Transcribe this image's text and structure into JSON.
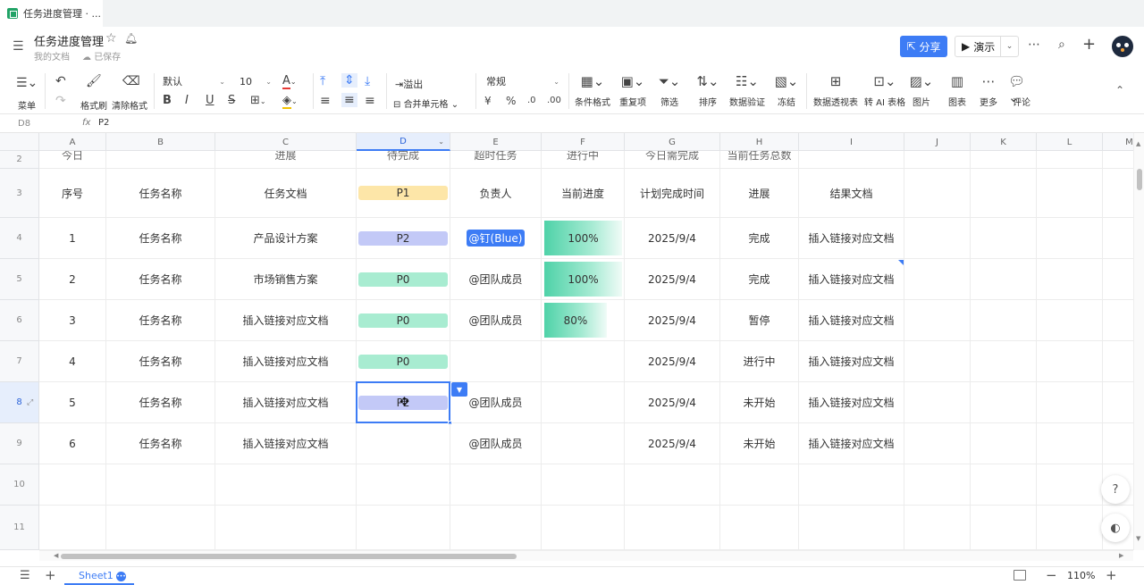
{
  "browser_tab": {
    "title": "任务进度管理 · ..."
  },
  "doc": {
    "title": "任务进度管理",
    "folder": "我的文档",
    "save_status": "已保存"
  },
  "header": {
    "share": "分享",
    "present": "演示"
  },
  "toolbar": {
    "menu": "菜单",
    "format_painter": "格式刷",
    "clear_format": "清除格式",
    "font_family": "默认",
    "font_size": "10",
    "overflow": "溢出",
    "merge_cells": "合并单元格",
    "number_format": "常规",
    "currency": "¥",
    "percent": "%",
    "conditional_format": "条件格式",
    "duplicates": "重复项",
    "filter": "筛选",
    "sort": "排序",
    "data_validation": "数据验证",
    "freeze": "冻结",
    "pivot_table": "数据透视表",
    "ai_table": "转 AI 表格",
    "image": "图片",
    "chart": "图表",
    "more": "更多",
    "comment": "评论"
  },
  "formula_bar": {
    "cell_ref": "D8",
    "fx": "fx",
    "value": "P2"
  },
  "columns": [
    "A",
    "B",
    "C",
    "D",
    "E",
    "F",
    "G",
    "H",
    "I",
    "J",
    "K",
    "L",
    "M"
  ],
  "row_partial": {
    "row": "2",
    "cells": [
      "今日",
      "",
      "进展",
      "待完成",
      "超时任务",
      "进行中",
      "今日需完成",
      "当前任务总数"
    ]
  },
  "header_row": {
    "row": "3",
    "cells": [
      "序号",
      "任务名称",
      "任务文档",
      "P1",
      "负责人",
      "当前进度",
      "计划完成时间",
      "进展",
      "结果文档"
    ]
  },
  "rows": [
    {
      "row": "4",
      "seq": "1",
      "name": "任务名称",
      "doc": "产品设计方案",
      "priority": "P2",
      "owner": "@钉(Blue)",
      "progress": "100%",
      "date": "2025/9/4",
      "status": "完成",
      "result": "插入链接对应文档"
    },
    {
      "row": "5",
      "seq": "2",
      "name": "任务名称",
      "doc": "市场销售方案",
      "priority": "P0",
      "owner": "@团队成员",
      "progress": "100%",
      "date": "2025/9/4",
      "status": "完成",
      "result": "插入链接对应文档"
    },
    {
      "row": "6",
      "seq": "3",
      "name": "任务名称",
      "doc": "插入链接对应文档",
      "priority": "P0",
      "owner": "@团队成员",
      "progress": "80%",
      "date": "2025/9/4",
      "status": "暂停",
      "result": "插入链接对应文档"
    },
    {
      "row": "7",
      "seq": "4",
      "name": "任务名称",
      "doc": "插入链接对应文档",
      "priority": "P0",
      "owner": "",
      "progress": "",
      "date": "2025/9/4",
      "status": "进行中",
      "result": "插入链接对应文档"
    },
    {
      "row": "8",
      "seq": "5",
      "name": "任务名称",
      "doc": "插入链接对应文档",
      "priority": "P2",
      "owner": "@团队成员",
      "progress": "",
      "date": "2025/9/4",
      "status": "未开始",
      "result": "插入链接对应文档"
    },
    {
      "row": "9",
      "seq": "6",
      "name": "任务名称",
      "doc": "插入链接对应文档",
      "priority": "",
      "owner": "@团队成员",
      "progress": "",
      "date": "2025/9/4",
      "status": "未开始",
      "result": "插入链接对应文档"
    }
  ],
  "empty_rows": [
    "10",
    "11"
  ],
  "priority_colors": {
    "P0": "#a8ecd1",
    "P1": "#fde6a8",
    "P2": "#c3c9f7"
  },
  "accent": "#3d7cf5",
  "bottom": {
    "sheet": "Sheet1",
    "zoom": "110%"
  }
}
